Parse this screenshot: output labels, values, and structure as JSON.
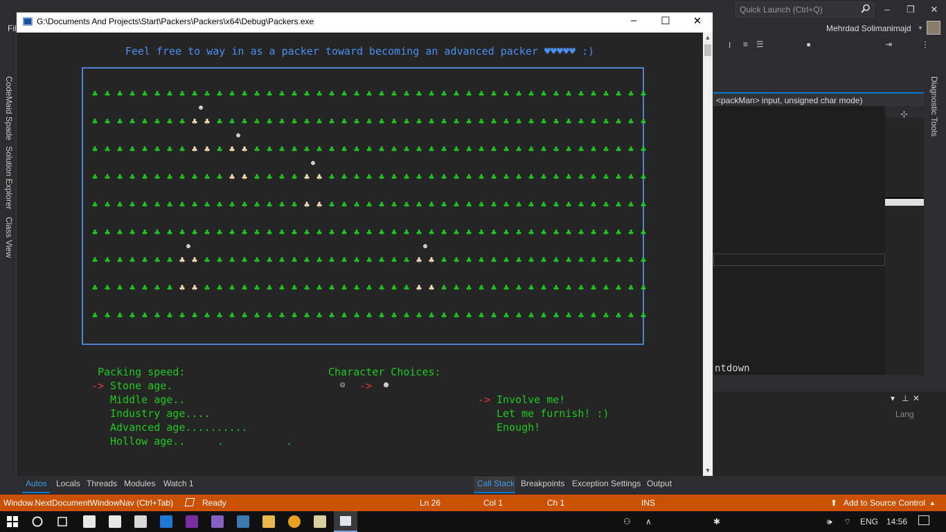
{
  "vs": {
    "quick_launch_placeholder": "Quick Launch (Ctrl+Q)",
    "user_name": "Mehrdad Solimanimajd",
    "left_rail_tabs": [
      "CodeMaid Spade",
      "Solution Explorer",
      "Class View"
    ],
    "right_rail_tab": "Diagnostic Tools",
    "editor_dropdown": "<packMan> input, unsigned char mode)",
    "editor_fragment": "ntdown",
    "lower_panel_column": "Lang",
    "bottom_tabs_left": [
      "Autos",
      "Locals",
      "Threads",
      "Modules",
      "Watch 1"
    ],
    "bottom_tabs_right": [
      "Call Stack",
      "Breakpoints",
      "Exception Settings",
      "Output"
    ],
    "file_menu_fragment": "Fil"
  },
  "status_bar": {
    "command": "Window.NextDocumentWindowNav (Ctrl+Tab)",
    "state": "Ready",
    "line": "Ln 26",
    "col": "Col 1",
    "ch": "Ch 1",
    "mode": "INS",
    "source_control": "Add to Source Control"
  },
  "taskbar": {
    "language": "ENG",
    "time": "14:56"
  },
  "console": {
    "title": "G:\\Documents And Projects\\Start\\Packers\\Packers\\x64\\Debug\\Packers.exe",
    "banner": "Feel free to way in as a packer toward becoming an advanced packer ♥♥♥♥♥ :)",
    "club_glyph": "♣",
    "face_glyph": "☻",
    "colors": {
      "club_green": "#1fc91f",
      "club_highlight": "#f3e3b4",
      "border_blue": "#4f7fd6",
      "banner_blue": "#4a8ff0",
      "arrow_red": "#e53a3a"
    },
    "speed_header": "Packing speed:",
    "speed_options": [
      "Stone age.",
      "Middle age..",
      "Industry age....",
      "Advanced age..........",
      "Hollow age.."
    ],
    "speed_selected_index": 0,
    "pointer": "->",
    "char_header": "Character Choices:",
    "char_from": "☺",
    "char_to": "☻",
    "actions": [
      "Involve me!",
      "Let me furnish! :)",
      "Enough!"
    ],
    "actions_selected_index": 0
  }
}
